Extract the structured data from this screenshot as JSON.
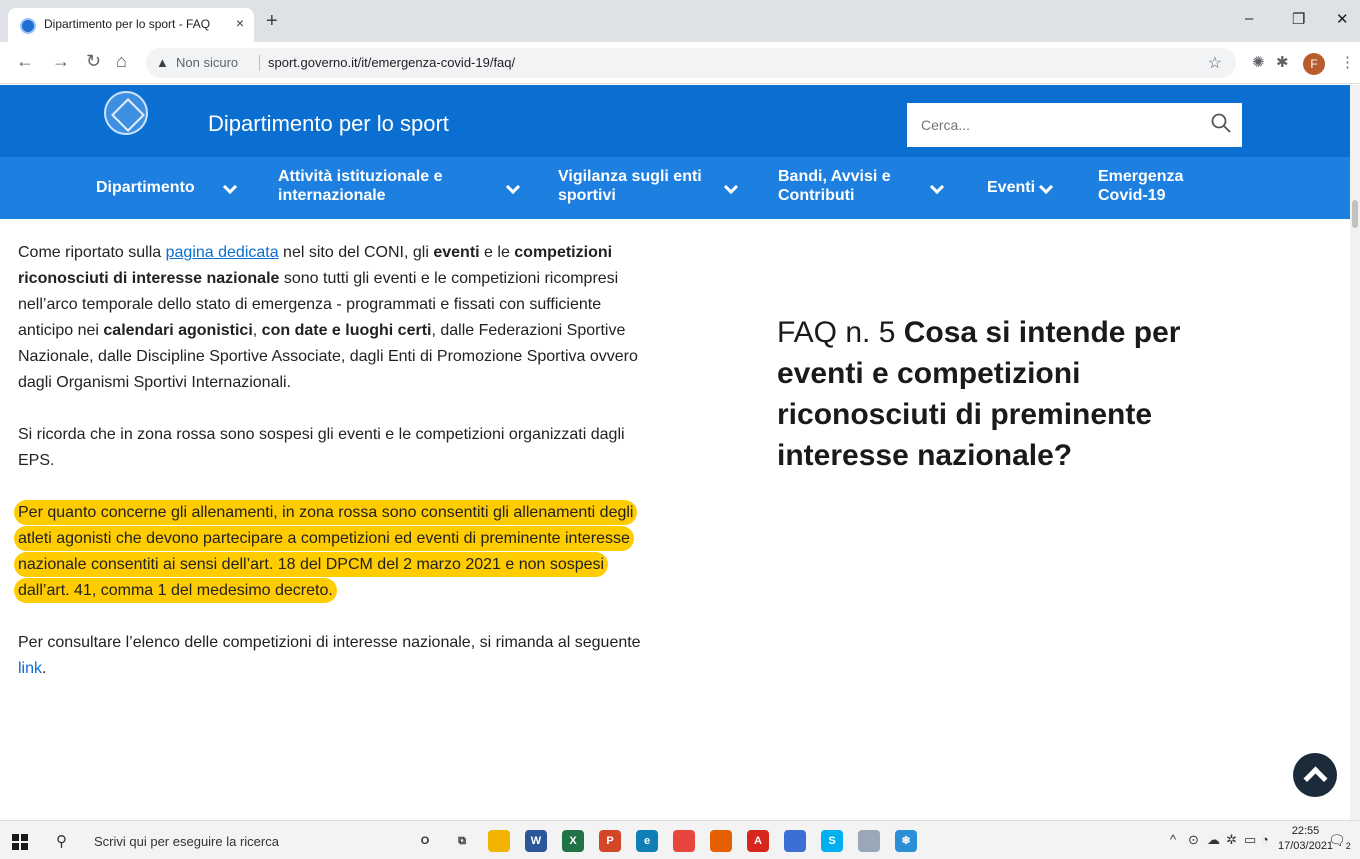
{
  "browser": {
    "tab_title": "Dipartimento per lo sport - FAQ",
    "tab_close": "×",
    "new_tab": "+",
    "minimize": "–",
    "restore": "❐",
    "close": "✕",
    "not_secure": "Non sicuro",
    "url": "sport.governo.it/it/emergenza-covid-19/faq/",
    "profile_initial": "F"
  },
  "site": {
    "title": "Dipartimento per lo sport",
    "search_placeholder": "Cerca...",
    "nav": [
      {
        "label_1": "Dipartimento",
        "label_2": ""
      },
      {
        "label_1": "Attività istituzionale e",
        "label_2": "internazionale"
      },
      {
        "label_1": "Vigilanza sugli enti",
        "label_2": "sportivi"
      },
      {
        "label_1": "Bandi, Avvisi e",
        "label_2": "Contributi"
      },
      {
        "label_1": "Eventi",
        "label_2": ""
      },
      {
        "label_1": "Emergenza",
        "label_2": "Covid-19"
      }
    ]
  },
  "content": {
    "p1": {
      "t1": "Come riportato sulla ",
      "link": "pagina dedicata",
      "t2": " nel sito del CONI, gli ",
      "b1": "eventi",
      "t3": " e le ",
      "b2": "competizioni riconosciuti di interesse nazionale",
      "t4": " sono tutti gli eventi e le competizioni ricompresi nell’arco temporale dello stato di emergenza - programmati e fissati con sufficiente anticipo nei ",
      "b3": "calendari agonistici",
      "t5": ", ",
      "b4": "con date e luoghi certi",
      "t6": ", dalle Federazioni Sportive Nazionale, dalle Discipline Sportive Associate, dagli Enti di Promozione Sportiva ovvero dagli Organismi Sportivi Internazionali."
    },
    "p2": "Si ricorda che in zona rossa sono sospesi gli eventi e le competizioni organizzati dagli EPS.",
    "p3": "Per quanto concerne gli allenamenti, in zona rossa sono consentiti gli allenamenti degli atleti agonisti che devono partecipare a competizioni ed eventi di preminente interesse nazionale consentiti ai sensi dell’art. 18 del DPCM del 2 marzo 2021 e non sospesi dall’art. 41, comma 1 del medesimo decreto.",
    "p4_text": "Per consultare l’elenco delle competizioni di interesse nazionale, si rimanda al seguente ",
    "p4_link": "link",
    "p4_end": "."
  },
  "faq": {
    "prefix": "FAQ n. 5 ",
    "question": "Cosa si intende per eventi e competizioni riconosciuti di preminente interesse nazionale?"
  },
  "taskbar": {
    "search_placeholder": "Scrivi qui per eseguire la ricerca",
    "time": "22:55",
    "date": "17/03/2021",
    "notifications": "2",
    "apps": [
      {
        "name": "cortana",
        "label": "O",
        "color": "#f3f3f3"
      },
      {
        "name": "task-view",
        "label": "⧉",
        "color": "#f3f3f3"
      },
      {
        "name": "file-explorer",
        "label": "",
        "color": "#f2b400"
      },
      {
        "name": "word",
        "label": "W",
        "color": "#2b579a"
      },
      {
        "name": "excel",
        "label": "X",
        "color": "#217346"
      },
      {
        "name": "powerpoint",
        "label": "P",
        "color": "#d24726"
      },
      {
        "name": "edge",
        "label": "e",
        "color": "#0f7fb5"
      },
      {
        "name": "chrome",
        "label": "",
        "color": "#e8453c"
      },
      {
        "name": "firefox",
        "label": "",
        "color": "#e66000"
      },
      {
        "name": "acrobat",
        "label": "A",
        "color": "#d7261c"
      },
      {
        "name": "app-blue",
        "label": "",
        "color": "#3b6fd6"
      },
      {
        "name": "skype",
        "label": "S",
        "color": "#00aff0"
      },
      {
        "name": "pdf24",
        "label": "",
        "color": "#9aa7b8"
      },
      {
        "name": "app-snow",
        "label": "❄",
        "color": "#2b8fd6"
      }
    ],
    "colors": {
      "accent": "#0b6ed1",
      "highlight": "#ffcc00"
    }
  }
}
